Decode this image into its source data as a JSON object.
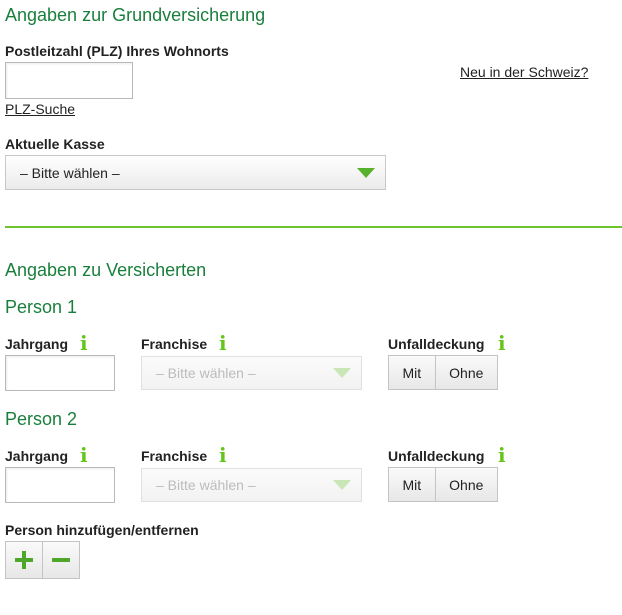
{
  "section_basic": {
    "title": "Angaben zur Grundversicherung",
    "zip_label": "Postleitzahl (PLZ) Ihres Wohnorts",
    "zip_value": "",
    "zip_search_link": "PLZ-Suche",
    "new_in_switzerland_link": "Neu in der Schweiz?",
    "insurer_label": "Aktuelle Kasse",
    "insurer_selected": "– Bitte wählen –"
  },
  "section_insured": {
    "title": "Angaben zu Versicherten",
    "persons": [
      {
        "title": "Person 1",
        "birth_year_label": "Jahrgang",
        "birth_year_value": "",
        "franchise_label": "Franchise",
        "franchise_selected": "– Bitte wählen –",
        "accident_label": "Unfalldeckung",
        "accident_options": [
          "Mit",
          "Ohne"
        ]
      },
      {
        "title": "Person 2",
        "birth_year_label": "Jahrgang",
        "birth_year_value": "",
        "franchise_label": "Franchise",
        "franchise_selected": "– Bitte wählen –",
        "accident_label": "Unfalldeckung",
        "accident_options": [
          "Mit",
          "Ohne"
        ]
      }
    ],
    "add_remove_label": "Person hinzufügen/entfernen"
  },
  "icons": {
    "info": "i"
  },
  "colors": {
    "heading_green": "#1a7f3c",
    "accent_green": "#6cc42e",
    "info_green": "#66c51d"
  }
}
